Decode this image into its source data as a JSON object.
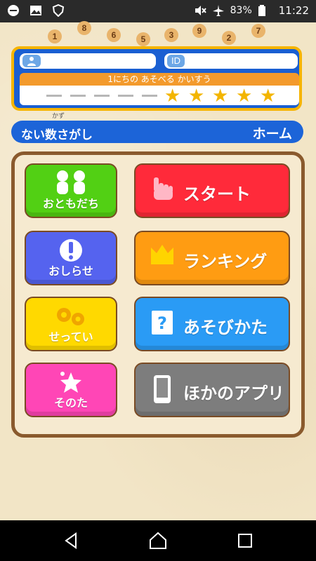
{
  "status_bar": {
    "icons_left": [
      "minus-circle-icon",
      "image-icon",
      "shield-icon"
    ],
    "icons_right": [
      "mute-icon",
      "airplane-icon"
    ],
    "battery": "83%",
    "time": "11:22"
  },
  "number_strip": [
    "1",
    "8",
    "6",
    "5",
    "3",
    "9",
    "2",
    "7"
  ],
  "profile": {
    "user_label_icon": "user-icon",
    "id_label": "ID",
    "daily_label": "1にちの あそべる かいすう",
    "stars_filled": 5
  },
  "title": {
    "app_name": "ない数さがし",
    "ruby": "かず",
    "home": "ホーム"
  },
  "menu": {
    "friends": "おともだち",
    "news": "おしらせ",
    "settings": "せってい",
    "other": "そのた",
    "start": "スタート",
    "ranking": "ランキング",
    "howto": "あそびかた",
    "other_apps": "ほかのアプリ"
  },
  "colors": {
    "panel_blue": "#1a5fd2",
    "panel_border": "#f6b400",
    "green": "#4fcf12",
    "blue": "#5764ee",
    "yellow": "#ffd900",
    "pink": "#ff46b6",
    "red": "#ff2a3a",
    "orange": "#ff9c12",
    "cyan": "#2a9bf5",
    "gray": "#7d7d7d"
  }
}
